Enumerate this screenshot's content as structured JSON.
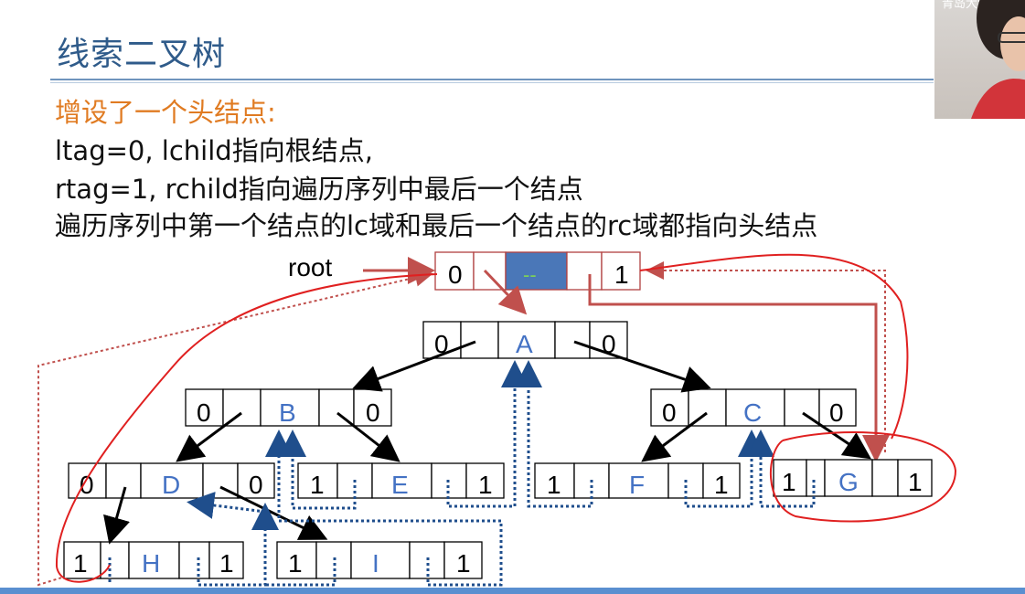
{
  "slide": {
    "title": "线索二叉树",
    "line1": "增设了一个头结点:",
    "line2": "ltag=0, lchild指向根结点,",
    "line3": "rtag=1, rchild指向遍历序列中最后一个结点",
    "line4": "遍历序列中第一个结点的lc域和最后一个结点的rc域都指向头结点"
  },
  "diagram": {
    "root_label": "root",
    "head_node": {
      "ltag": "0",
      "data": "--",
      "rtag": "1"
    },
    "nodes": [
      {
        "id": "A",
        "ltag": "0",
        "data": "A",
        "rtag": "0"
      },
      {
        "id": "B",
        "ltag": "0",
        "data": "B",
        "rtag": "0"
      },
      {
        "id": "C",
        "ltag": "0",
        "data": "C",
        "rtag": "0"
      },
      {
        "id": "D",
        "ltag": "0",
        "data": "D",
        "rtag": "0"
      },
      {
        "id": "E",
        "ltag": "1",
        "data": "E",
        "rtag": "1"
      },
      {
        "id": "F",
        "ltag": "1",
        "data": "F",
        "rtag": "1"
      },
      {
        "id": "G",
        "ltag": "1",
        "data": "G",
        "rtag": "1"
      },
      {
        "id": "H",
        "ltag": "1",
        "data": "H",
        "rtag": "1"
      },
      {
        "id": "I",
        "ltag": "1",
        "data": "I",
        "rtag": "1"
      }
    ]
  },
  "webcam": {
    "partial_text": "青岛大学"
  },
  "colors": {
    "title": "#2f5b8a",
    "highlight": "#e07b22",
    "node_letter": "#4472c4",
    "head_data_fill": "#4a77b8",
    "thread_dotted": "#1f4e8c",
    "annotation_red": "#e02020",
    "head_thread": "#c0504d"
  }
}
